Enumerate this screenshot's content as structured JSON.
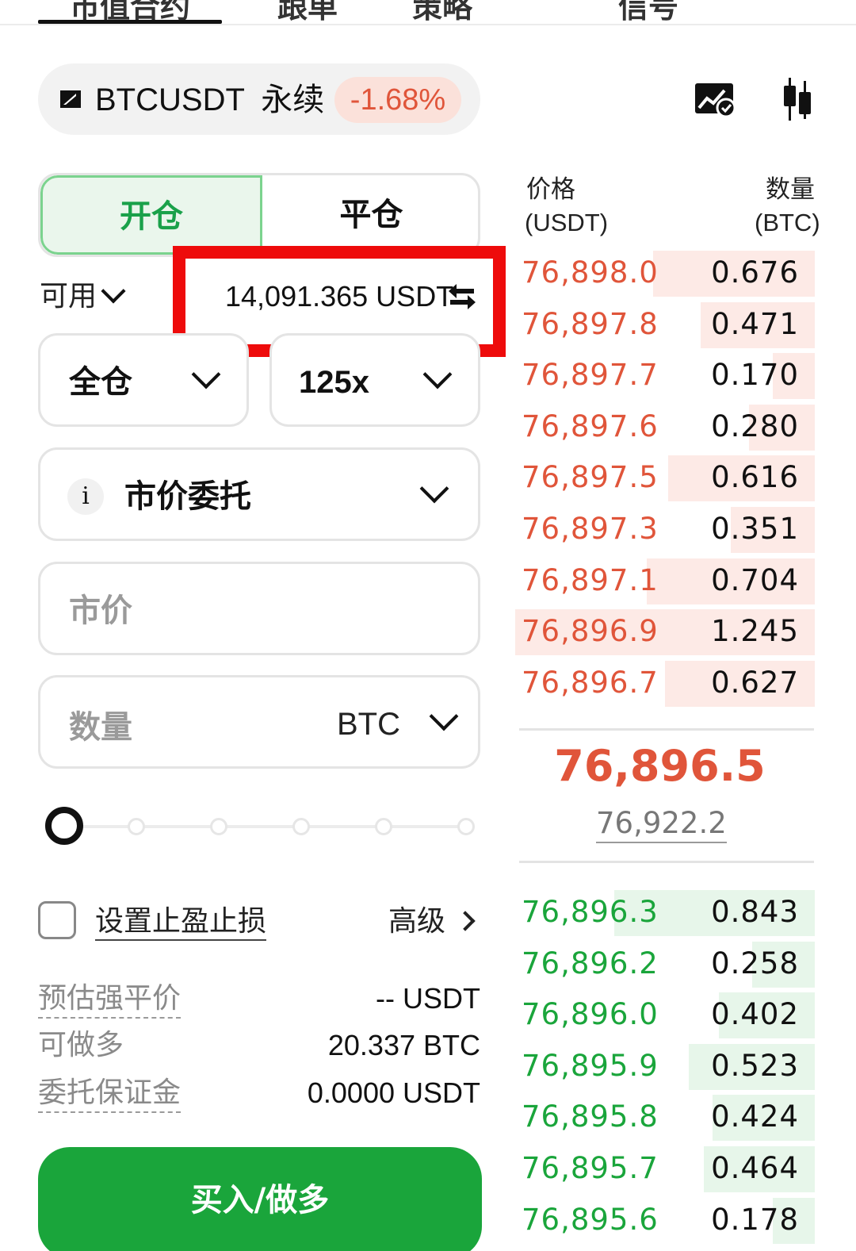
{
  "top_tabs": [
    "市值合约",
    "跟单",
    "策略",
    "信号"
  ],
  "pair": {
    "symbol": "BTCUSDT",
    "type": "永续",
    "change": "-1.68%"
  },
  "icons": {
    "pair": "pair-logo-icon",
    "chart": "chart-settings-icon",
    "candle": "candlestick-icon",
    "swap": "transfer-swap-icon"
  },
  "colors": {
    "buy": "#1aa53b",
    "sell": "#e0553a",
    "highlight": "#ee0b0b"
  },
  "position_tabs": {
    "open": "开仓",
    "close": "平仓"
  },
  "available": {
    "label": "可用",
    "value": "14,091.365 USDT"
  },
  "margin_mode": "全仓",
  "leverage": "125x",
  "order_type": {
    "info_icon": "i",
    "label": "市价委托"
  },
  "price_field": {
    "placeholder": "市价"
  },
  "quantity_field": {
    "placeholder": "数量",
    "unit": "BTC"
  },
  "slider": {
    "percent": 0
  },
  "tpsl": {
    "label": "设置止盈止损",
    "advanced": "高级"
  },
  "info": [
    {
      "key": "预估强平价",
      "value": "-- USDT"
    },
    {
      "key": "可做多",
      "value": "20.337 BTC"
    },
    {
      "key": "委托保证金",
      "value": "0.0000 USDT"
    }
  ],
  "buy_button": "买入/做多",
  "orderbook": {
    "header": {
      "price_label": "价格",
      "price_unit": "(USDT)",
      "qty_label": "数量",
      "qty_unit": "(BTC)"
    },
    "asks": [
      {
        "price": "76,898.0",
        "qty": "0.676",
        "depth": 0.54
      },
      {
        "price": "76,897.8",
        "qty": "0.471",
        "depth": 0.38
      },
      {
        "price": "76,897.7",
        "qty": "0.170",
        "depth": 0.14
      },
      {
        "price": "76,897.6",
        "qty": "0.280",
        "depth": 0.22
      },
      {
        "price": "76,897.5",
        "qty": "0.616",
        "depth": 0.49
      },
      {
        "price": "76,897.3",
        "qty": "0.351",
        "depth": 0.28
      },
      {
        "price": "76,897.1",
        "qty": "0.704",
        "depth": 0.56
      },
      {
        "price": "76,896.9",
        "qty": "1.245",
        "depth": 1.0
      },
      {
        "price": "76,896.7",
        "qty": "0.627",
        "depth": 0.5
      }
    ],
    "last_price": "76,896.5",
    "mark_price": "76,922.2",
    "bids": [
      {
        "price": "76,896.3",
        "qty": "0.843",
        "depth": 0.67
      },
      {
        "price": "76,896.2",
        "qty": "0.258",
        "depth": 0.21
      },
      {
        "price": "76,896.0",
        "qty": "0.402",
        "depth": 0.32
      },
      {
        "price": "76,895.9",
        "qty": "0.523",
        "depth": 0.42
      },
      {
        "price": "76,895.8",
        "qty": "0.424",
        "depth": 0.34
      },
      {
        "price": "76,895.7",
        "qty": "0.464",
        "depth": 0.37
      },
      {
        "price": "76,895.6",
        "qty": "0.178",
        "depth": 0.14
      }
    ]
  }
}
